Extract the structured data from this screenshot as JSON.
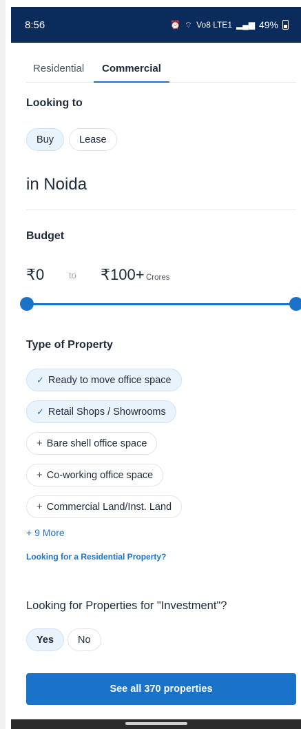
{
  "status": {
    "time": "8:56",
    "battery": "49%",
    "network": "Vo8 LTE1"
  },
  "tabs": [
    {
      "label": "Residential",
      "active": false
    },
    {
      "label": "Commercial",
      "active": true
    }
  ],
  "looking_to": {
    "label": "Looking to",
    "options": [
      {
        "label": "Buy",
        "selected": true
      },
      {
        "label": "Lease",
        "selected": false
      }
    ]
  },
  "location": {
    "text": "in Noida"
  },
  "budget": {
    "label": "Budget",
    "min": "₹0",
    "to": "to",
    "max": "₹100+",
    "unit": "Crores",
    "range_fraction": [
      0,
      1
    ]
  },
  "property_type": {
    "label": "Type of Property",
    "options": [
      {
        "label": "Ready to move office space",
        "selected": true
      },
      {
        "label": "Retail Shops / Showrooms",
        "selected": true
      },
      {
        "label": "Bare shell office space",
        "selected": false
      },
      {
        "label": "Co-working office space",
        "selected": false
      },
      {
        "label": "Commercial Land/Inst. Land",
        "selected": false
      }
    ],
    "more": "+ 9 More",
    "residential_link": "Looking for a Residential Property?"
  },
  "investment": {
    "label": "Looking for Properties for \"Investment\"?",
    "options": [
      {
        "label": "Yes",
        "selected": true
      },
      {
        "label": "No",
        "selected": false
      }
    ]
  },
  "cta": {
    "label": "See all 370 properties"
  },
  "colors": {
    "accent": "#1a73c9",
    "status_bar": "#0a2b5c",
    "selected_pill": "#e8f3fc"
  }
}
